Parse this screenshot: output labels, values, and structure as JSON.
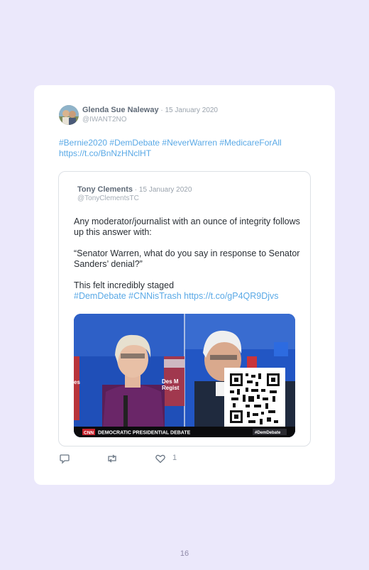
{
  "tweet": {
    "author_name": "Glenda Sue Naleway",
    "date": " · 15 January 2020",
    "handle": "@IWANT2NO",
    "text_line1": "#Bernie2020 #DemDebate #NeverWarren #MedicareForAll",
    "text_line2": "https://t.co/BnNzHNclHT",
    "like_count": "1"
  },
  "quoted": {
    "author_name": "Tony Clements",
    "date": " · 15 January 2020",
    "handle": "@TonyClementsTC",
    "line1": "Any moderator/journalist with an ounce of integrity follows up this answer with:",
    "line2": "“Senator Warren, what do you say in response to Senator Sanders’ denial?”",
    "line3": "This felt incredibly staged",
    "hashtags": "#DemDebate #CNNisTrash ",
    "link": "https://t.co/gP4QR9Djvs",
    "media": {
      "banner_text": "DEMOCRATIC PRESIDENTIAL DEBATE",
      "network": "CNN",
      "tag": "#DemDebate",
      "backdrop_text": "Des M… Regist…",
      "left_edge_text": "es"
    }
  },
  "icons": {
    "reply": "reply-icon",
    "retweet": "retweet-icon",
    "like": "heart-icon"
  },
  "page_number": "16"
}
